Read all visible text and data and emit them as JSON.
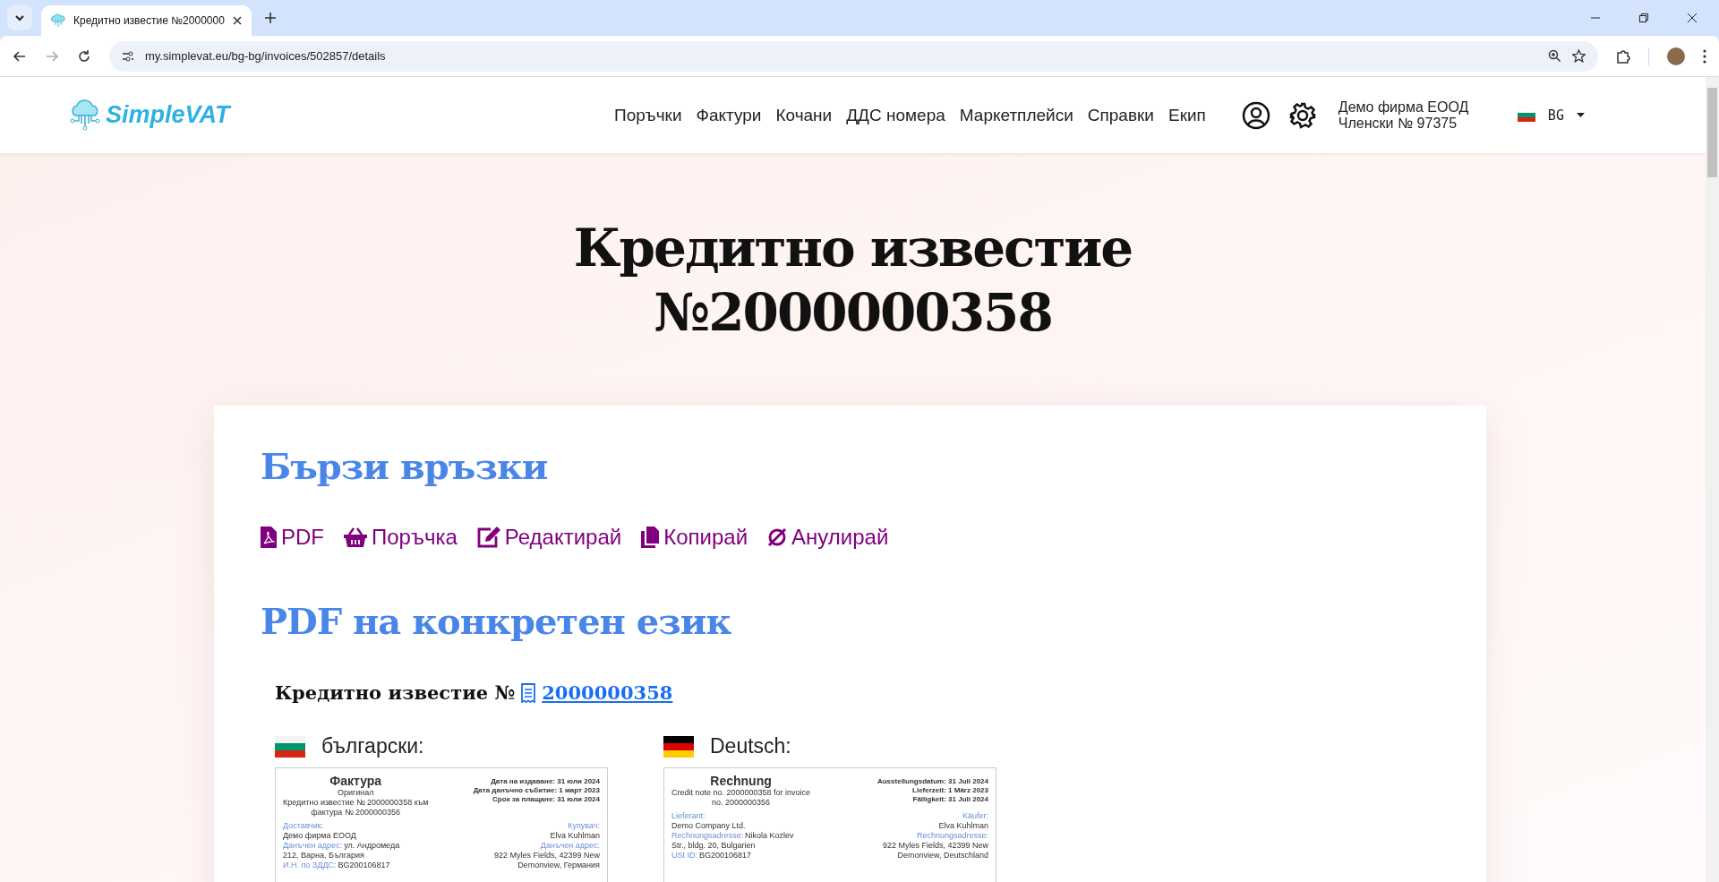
{
  "browser": {
    "tab_title": "Кредитно известие №2000000",
    "url": "my.simplevat.eu/bg-bg/invoices/502857/details"
  },
  "header": {
    "logo": "SimpleVAT",
    "nav": [
      "Поръчки",
      "Фактури",
      "Кочани",
      "ДДС номера",
      "Маркетплейси",
      "Справки",
      "Екип"
    ],
    "company": "Демо фирма ЕООД",
    "membership": "Членски № 97375",
    "language": "BG"
  },
  "title_lines": [
    "Кредитно известие",
    "№2000000358"
  ],
  "quick_links": {
    "heading": "Бързи връзки",
    "links": [
      {
        "kind": "pdf",
        "label": "PDF"
      },
      {
        "kind": "basket",
        "label": "Поръчка"
      },
      {
        "kind": "edit",
        "label": "Редактирай"
      },
      {
        "kind": "copy",
        "label": "Копирай"
      },
      {
        "kind": "cancel",
        "label": "Анулирай"
      }
    ]
  },
  "language_pdfs": {
    "heading": "PDF на конкретен език",
    "document_label": "Кредитно известие №",
    "document_number": "2000000358",
    "languages": [
      {
        "kind": "bg",
        "name": "български:",
        "preview": {
          "title": "Фактура",
          "subtitle": [
            "Оригинал",
            "Кредитно известие № 2000000358 към",
            "фактура № 2000000356"
          ],
          "dates": [
            "Дата на издаване: 31 юли 2024",
            "Дата данъчно събитие: 1 март 2023",
            "Срок за плащане: 31 юли 2024"
          ],
          "seller": {
            "heading": "Доставчик:",
            "lines": [
              {
                "text": "Демо фирма ЕООД"
              },
              {
                "label": "Данъчен адрес:",
                "text": "ул. Андромеда"
              },
              {
                "text": "212, Варна, България"
              },
              {
                "label": "И.Н. по ЗДДС:",
                "text": "BG200106817"
              }
            ]
          },
          "buyer": {
            "heading": "Купувач:",
            "lines": [
              {
                "text": "Elva Kuhlman"
              },
              {
                "label": "Данъчен адрес:"
              },
              {
                "text": "922 Myles Fields, 42399 New"
              },
              {
                "text": "Demonview, Германия"
              }
            ]
          }
        }
      },
      {
        "kind": "de",
        "name": "Deutsch:",
        "preview": {
          "title": "Rechnung",
          "subtitle": [
            "Credit note no. 2000000358 for invoice",
            "no. 2000000356"
          ],
          "dates": [
            "Ausstellungsdatum: 31 Juli 2024",
            "Lieferzeit: 1 März 2023",
            "Fälligkeit: 31 Juli 2024"
          ],
          "seller": {
            "heading": "Lieferant:",
            "lines": [
              {
                "text": "Demo Company Ltd."
              },
              {
                "label": "Rechnungsadresse:",
                "text": "Nikola Kozlev"
              },
              {
                "text": "Str., bldg. 20, Bulgarien"
              },
              {
                "label": "USt ID:",
                "text": "BG200106817"
              }
            ]
          },
          "buyer": {
            "heading": "Käufer:",
            "lines": [
              {
                "text": "Elva Kuhlman"
              },
              {
                "label": "Rechnungsadresse:"
              },
              {
                "text": "922 Myles Fields, 42399 New"
              },
              {
                "text": "Demonview, Deutschland"
              }
            ]
          }
        }
      }
    ]
  }
}
